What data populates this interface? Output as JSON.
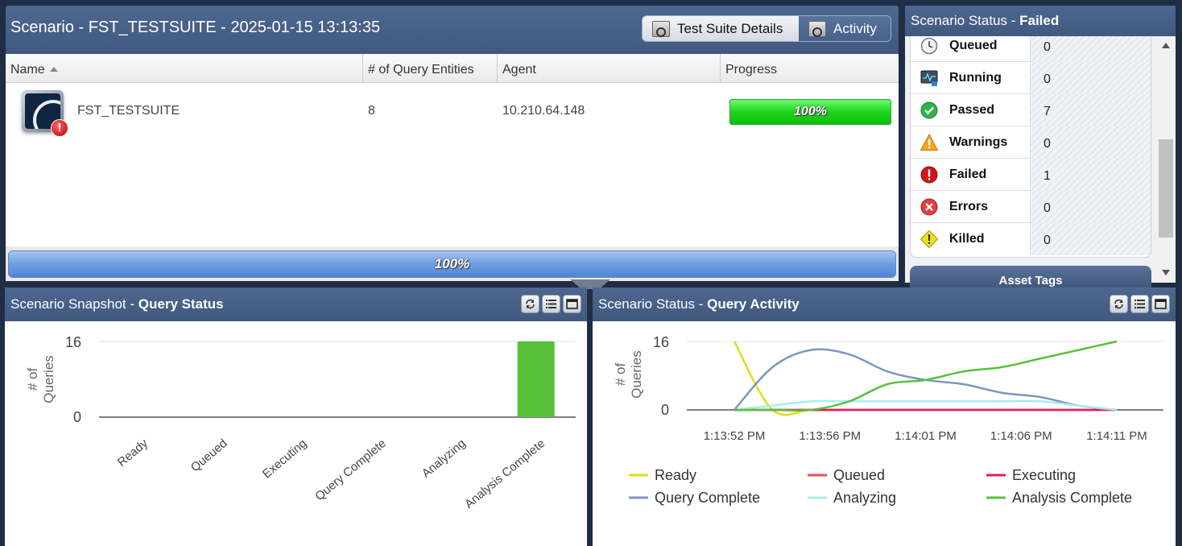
{
  "scenario": {
    "title": "Scenario - FST_TESTSUITE - 2025-01-15 13:13:35",
    "tabs": [
      {
        "label": "Test Suite Details"
      },
      {
        "label": "Activity"
      }
    ],
    "columns": [
      "Name",
      "# of Query Entities",
      "Agent",
      "Progress"
    ],
    "row": {
      "name": "FST_TESTSUITE",
      "query_entities": "8",
      "agent": "10.210.64.148",
      "progress_label": "100%",
      "progress_fraction": 1.0
    },
    "overall_progress_label": "100%",
    "overall_progress_fraction": 1.0
  },
  "status_panel": {
    "title_prefix": "Scenario Status - ",
    "title_status": "Failed",
    "rows": [
      {
        "label": "Queued",
        "value": "0",
        "icon": "clock-icon"
      },
      {
        "label": "Running",
        "value": "0",
        "icon": "monitor-icon"
      },
      {
        "label": "Passed",
        "value": "7",
        "icon": "check-circle-icon"
      },
      {
        "label": "Warnings",
        "value": "0",
        "icon": "warning-triangle-icon"
      },
      {
        "label": "Failed",
        "value": "1",
        "icon": "exclamation-circle-icon"
      },
      {
        "label": "Errors",
        "value": "0",
        "icon": "x-circle-icon"
      },
      {
        "label": "Killed",
        "value": "0",
        "icon": "exclamation-diamond-icon"
      }
    ],
    "asset_tags_label": "Asset Tags"
  },
  "snapshot_panel": {
    "title_prefix": "Scenario Snapshot - ",
    "title_bold": "Query Status"
  },
  "activity_panel": {
    "title_prefix": "Scenario Status - ",
    "title_bold": "Query Activity"
  },
  "colors": {
    "header": "#4a628a",
    "ready": "#dede1c",
    "queued": "#e15252",
    "executing": "#e6176f",
    "query_complete": "#7b97c0",
    "analyzing": "#a8ecec",
    "analysis_complete": "#55c23a"
  },
  "chart_data": [
    {
      "type": "bar",
      "ylabel": "# of Queries",
      "ylim": [
        0,
        16
      ],
      "yticks": [
        "0",
        "16"
      ],
      "categories": [
        "Ready",
        "Queued",
        "Executing",
        "Query Complete",
        "Analyzing",
        "Analysis Complete"
      ],
      "values": [
        0,
        0,
        0,
        0,
        0,
        16
      ],
      "grid": true
    },
    {
      "type": "line",
      "ylabel": "# of Queries",
      "ylim": [
        0,
        16
      ],
      "yticks": [
        "0",
        "16"
      ],
      "xticks": [
        "1:13:52 PM",
        "1:13:56 PM",
        "1:14:01 PM",
        "1:14:06 PM",
        "1:14:11 PM"
      ],
      "legend_position": "bottom",
      "series": [
        {
          "name": "Ready",
          "color": "#dede1c",
          "values": [
            16,
            0,
            0,
            0,
            0,
            0,
            0,
            0,
            0,
            0,
            0
          ]
        },
        {
          "name": "Queued",
          "color": "#e15252",
          "values": [
            0,
            0,
            0,
            0,
            0,
            0,
            0,
            0,
            0,
            0,
            0
          ]
        },
        {
          "name": "Executing",
          "color": "#e6176f",
          "values": [
            0,
            0,
            0,
            0,
            0,
            0,
            0,
            0,
            0,
            0,
            0
          ]
        },
        {
          "name": "Query Complete",
          "color": "#7b97c0",
          "values": [
            0,
            10,
            14,
            13,
            9,
            7,
            6,
            4,
            3,
            1,
            0
          ]
        },
        {
          "name": "Analyzing",
          "color": "#a8ecec",
          "values": [
            0,
            1,
            2,
            2,
            2,
            2,
            2,
            2,
            2,
            1,
            0
          ]
        },
        {
          "name": "Analysis Complete",
          "color": "#55c23a",
          "values": [
            0,
            0,
            0,
            2,
            6,
            7,
            9,
            10,
            12,
            14,
            16
          ]
        }
      ]
    }
  ]
}
